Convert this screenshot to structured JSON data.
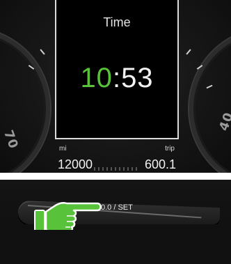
{
  "display": {
    "title": "Time",
    "clock": {
      "hours": "10",
      "separator": ":",
      "minutes": "53"
    },
    "odometer": {
      "unit_label": "mi",
      "value": "12000"
    },
    "trip": {
      "label": "trip",
      "value": "600.1"
    }
  },
  "gauges": {
    "left_number": "70",
    "right_number": "40"
  },
  "control": {
    "button_label": "0.0 / SET"
  },
  "colors": {
    "clock_hours": "#58c23a",
    "hand": "#58c23a",
    "divider": "#ffffff"
  },
  "icons": {
    "pointer": "pointing-hand-icon"
  }
}
